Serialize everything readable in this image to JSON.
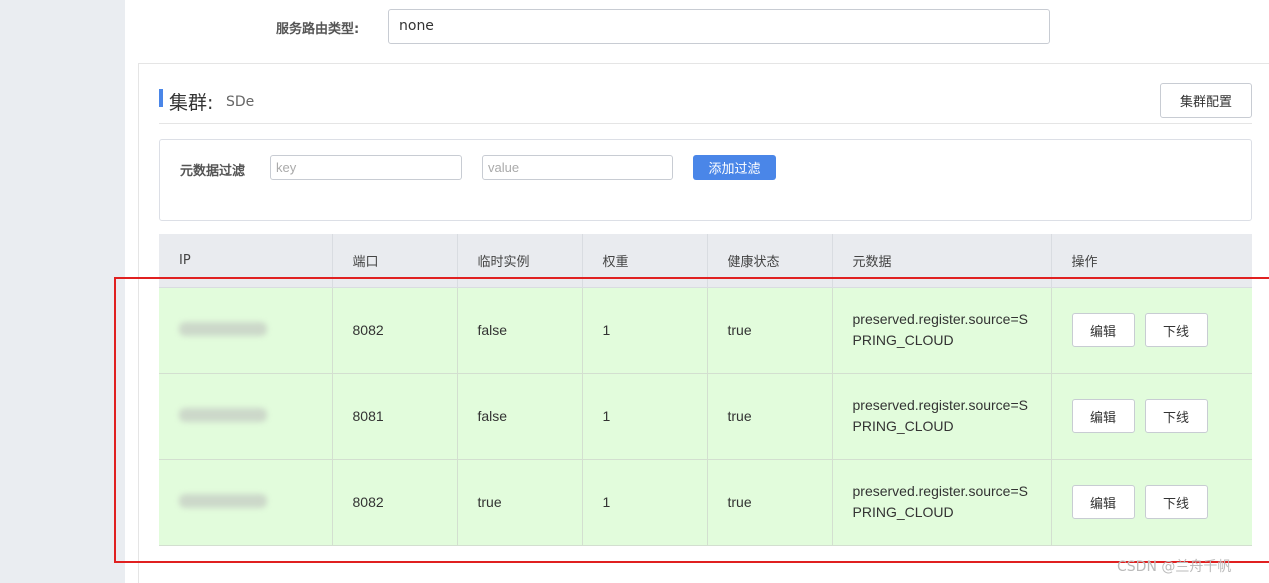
{
  "service": {
    "route_type_label": "服务路由类型:",
    "route_type_value": "none"
  },
  "cluster": {
    "title": "集群:",
    "name": "SDe",
    "config_button": "集群配置"
  },
  "filter": {
    "label": "元数据过滤",
    "key_placeholder": "key",
    "value_placeholder": "value",
    "add_button": "添加过滤"
  },
  "table": {
    "headers": [
      "IP",
      "端口",
      "临时实例",
      "权重",
      "健康状态",
      "元数据",
      "操作"
    ],
    "rows": [
      {
        "ip": "",
        "port": "8082",
        "ephemeral": "false",
        "weight": "1",
        "healthy": "true",
        "metadata": "preserved.register.source=SPRING_CLOUD",
        "edit": "编辑",
        "offline": "下线"
      },
      {
        "ip": "",
        "port": "8081",
        "ephemeral": "false",
        "weight": "1",
        "healthy": "true",
        "metadata": "preserved.register.source=SPRING_CLOUD",
        "edit": "编辑",
        "offline": "下线"
      },
      {
        "ip": "",
        "port": "8082",
        "ephemeral": "true",
        "weight": "1",
        "healthy": "true",
        "metadata": "preserved.register.source=SPRING_CLOUD",
        "edit": "编辑",
        "offline": "下线"
      }
    ]
  },
  "watermark": "CSDN @兰舟千帆",
  "colors": {
    "accent": "#4a86e8",
    "row_healthy_bg": "#e2fcdc",
    "header_bg": "#e9ebef",
    "highlight": "#e02020"
  }
}
